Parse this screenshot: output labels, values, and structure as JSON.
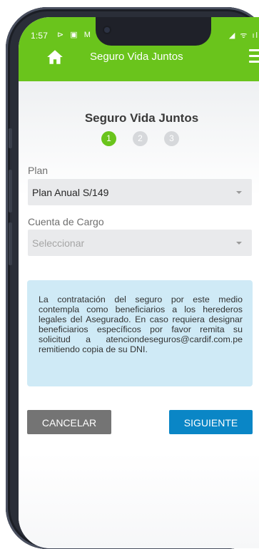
{
  "status_bar": {
    "time": "1:57",
    "left_icons": "⊳ ▣ M ⋅",
    "right_icons": "◢ ᯤ ıl"
  },
  "header": {
    "title": "Seguro Vida Juntos",
    "color": "#6ac41c"
  },
  "page": {
    "title": "Seguro Vida Juntos",
    "steps": [
      {
        "label": "1",
        "active": true
      },
      {
        "label": "2",
        "active": false
      },
      {
        "label": "3",
        "active": false
      }
    ]
  },
  "form": {
    "plan": {
      "label": "Plan",
      "value": "Plan Anual S/149"
    },
    "cuenta": {
      "label": "Cuenta de Cargo",
      "placeholder": "Seleccionar"
    }
  },
  "info": {
    "text": "La contratación del seguro por este medio contempla como beneficiarios a los herederos legales del Asegurado. En caso requiera designar beneficiarios específicos por favor remita su solicitud a atenciondeseguros@cardif.com.pe remitiendo copia de su DNI."
  },
  "buttons": {
    "cancel": "CANCELAR",
    "next": "SIGUIENTE"
  },
  "colors": {
    "accent_green": "#6ac41c",
    "button_blue": "#0a86c6",
    "button_gray": "#747474",
    "info_bg": "#cfeaf6"
  }
}
